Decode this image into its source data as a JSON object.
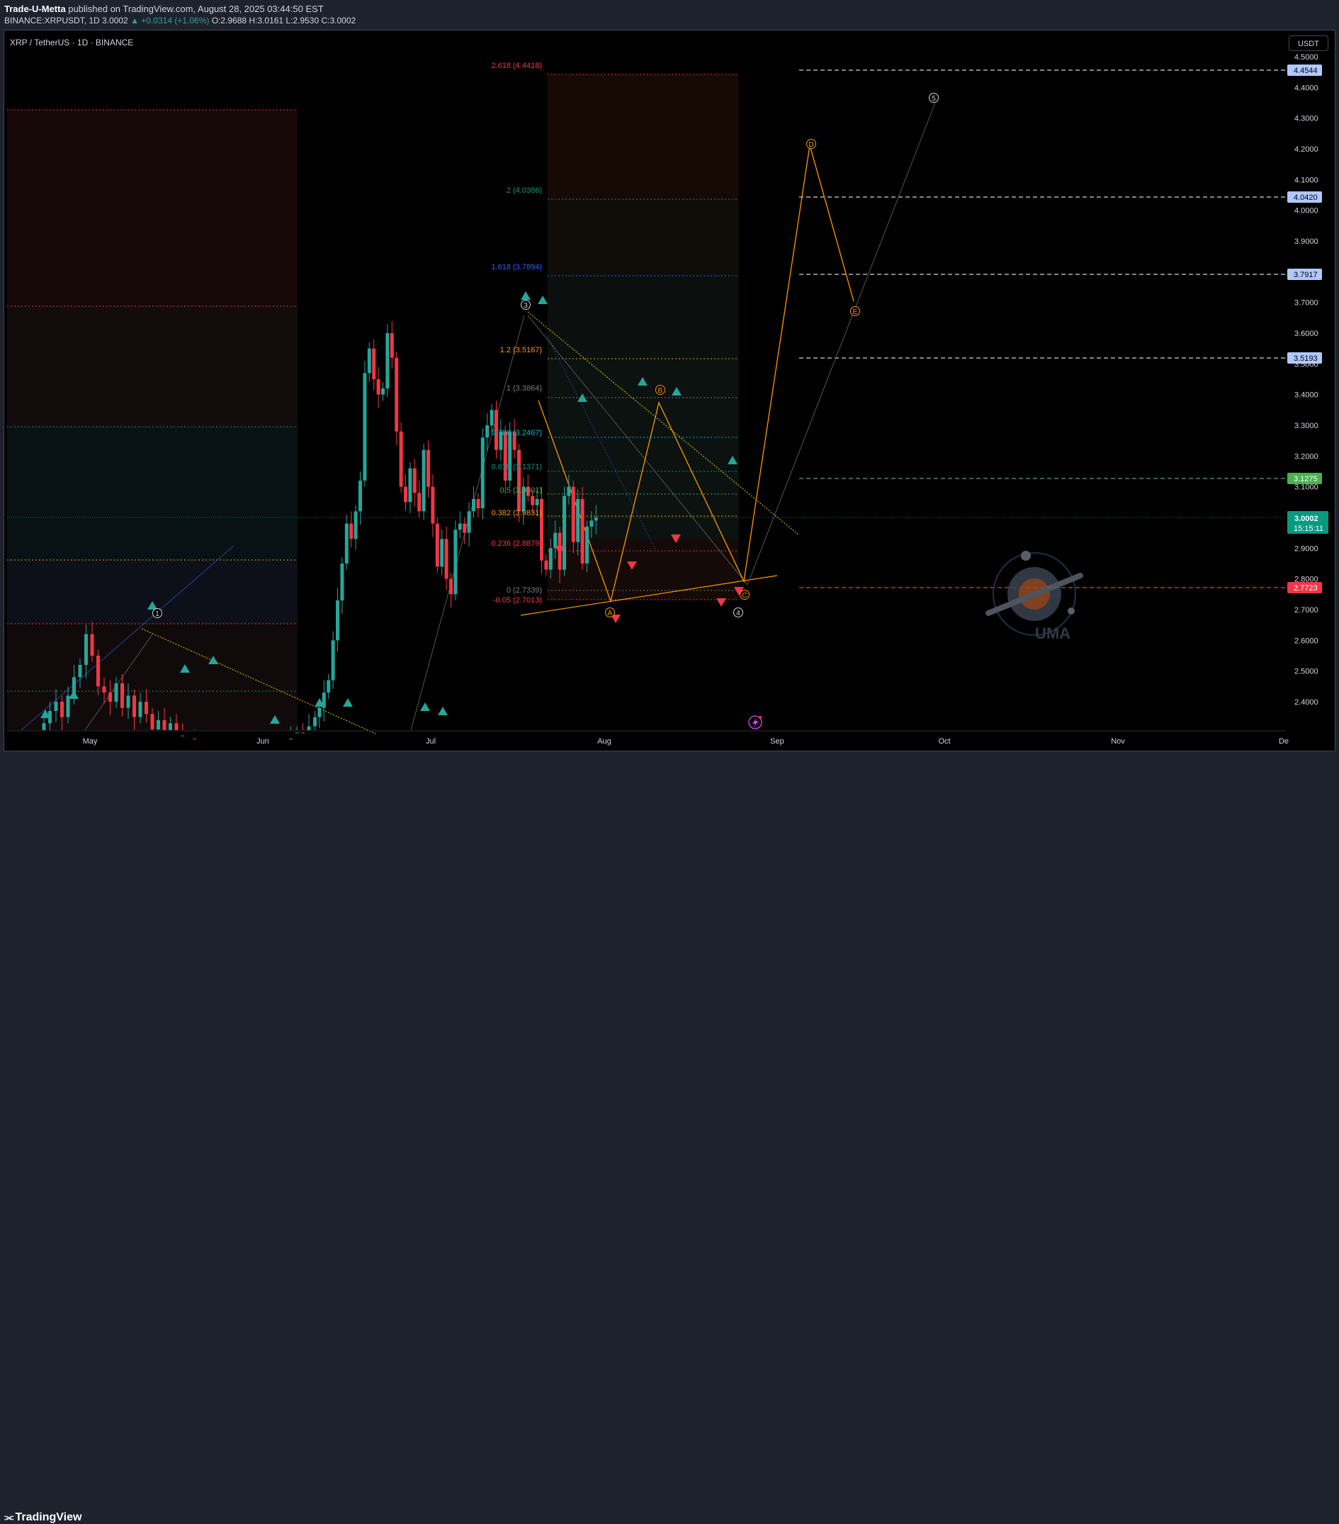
{
  "header": {
    "author": "Trade-U-Metta",
    "published_text": " published on TradingView.com, August 28, 2025 03:44:50 EST",
    "symbol_prefix": "BINANCE:XRPUSDT, 1D 3.0002 ",
    "change_text": "▲ +0.0314 (+1.06%)",
    "ohlc_text": " O:2.9688 H:3.0161 L:2.9530 C:3.0002"
  },
  "chart": {
    "pair_title": "XRP / TetherUS · 1D · BINANCE",
    "currency": "USDT",
    "price_ticks": [
      "4.5000",
      "4.4000",
      "4.3000",
      "4.2000",
      "4.1000",
      "4.0000",
      "3.9000",
      "3.8000",
      "3.7000",
      "3.6000",
      "3.5000",
      "3.4000",
      "3.3000",
      "3.2000",
      "3.1000",
      "3.0000",
      "2.9000",
      "2.8000",
      "2.7000",
      "2.6000",
      "2.5000",
      "2.4000"
    ],
    "time_labels": [
      "May",
      "Jun",
      "Jul",
      "Aug",
      "Sep",
      "Oct",
      "Nov",
      "De"
    ],
    "price_badges": [
      {
        "label": "4.4544",
        "kind": "level"
      },
      {
        "label": "4.0420",
        "kind": "level"
      },
      {
        "label": "3.7917",
        "kind": "level"
      },
      {
        "label": "3.5193",
        "kind": "level"
      },
      {
        "label": "3.1275",
        "kind": "green"
      },
      {
        "label": "2.7723",
        "kind": "red"
      }
    ],
    "current_price": {
      "label": "3.0002",
      "countdown": "15:15:11"
    },
    "fib_labels": [
      {
        "label": "2.618 (4.4418)",
        "color": "#f23645"
      },
      {
        "label": "2 (4.0386)",
        "color": "#089981"
      },
      {
        "label": "1.618 (3.7894)",
        "color": "#2962ff"
      },
      {
        "label": "1.2 (3.5167)",
        "color": "#ff9800"
      },
      {
        "label": "1 (3.3864)",
        "color": "#787b86"
      },
      {
        "label": "0.786 (3.2467)",
        "color": "#00bcd4"
      },
      {
        "label": "0.618 (3.1371)",
        "color": "#089981"
      },
      {
        "label": "0.5 (3.0601)",
        "color": "#4caf50"
      },
      {
        "label": "0.382 (2.9831)",
        "color": "#ff9800"
      },
      {
        "label": "0.236 (2.8879)",
        "color": "#f23645"
      },
      {
        "label": "0 (2.7339)",
        "color": "#787b86"
      },
      {
        "label": "-0.05 (2.7013)",
        "color": "#f23645"
      }
    ],
    "wave_labels": {
      "w1": "1",
      "w3": "3",
      "w4": "4",
      "w5": "5",
      "wA": "A",
      "wB": "B",
      "wC": "C",
      "wD": "D",
      "wE": "E"
    },
    "watermark": "UMA",
    "colors": {
      "up": "#26a69a",
      "down": "#f23645",
      "background": "#000000",
      "accent": "#ff9800",
      "level_badge": "#b2c8ff",
      "green_badge": "#4caf50",
      "red_badge": "#f23645"
    }
  },
  "footer": {
    "logo_text": "TradingView"
  },
  "icons": [
    "tradingview-logo-icon",
    "lightning-icon",
    "uma-logo-icon"
  ]
}
